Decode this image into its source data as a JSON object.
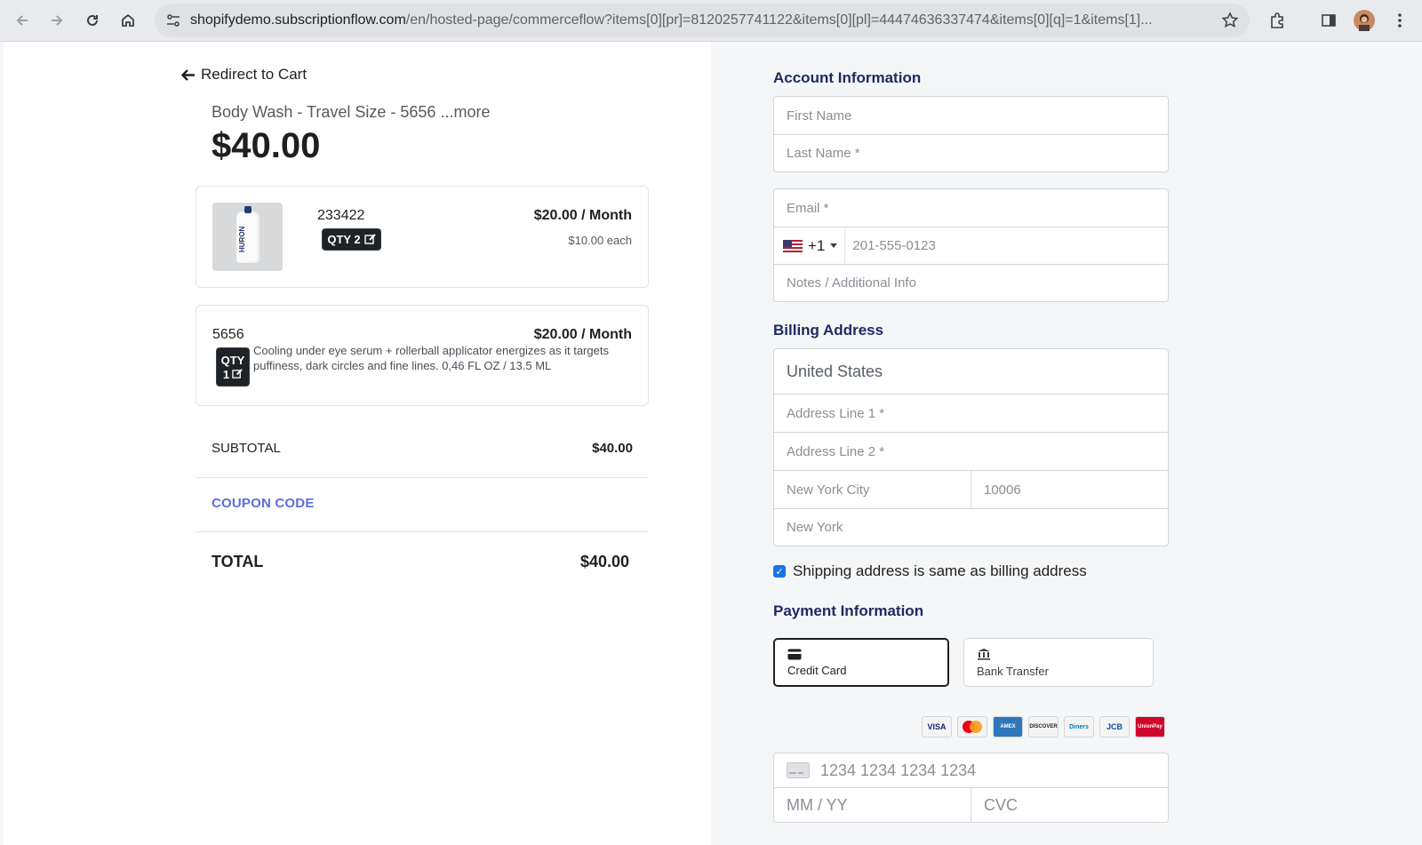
{
  "browser": {
    "url_host": "shopifydemo.subscriptionflow.com",
    "url_path": "/en/hosted-page/commerceflow?items[0][pr]=8120257741122&items[0][pl]=44474636337474&items[0][q]=1&items[1]..."
  },
  "cart": {
    "redirect_label": "Redirect to Cart",
    "product_title": "Body Wash - Travel Size - 5656",
    "more_label": " ...more",
    "price": "$40.00",
    "items": [
      {
        "sku": "233422",
        "qty": "QTY 2",
        "price": "$20.00 / Month",
        "each": "$10.00 each",
        "brand": "HURON"
      },
      {
        "sku": "5656",
        "qty_line1": "QTY",
        "qty_line2": "1",
        "price": "$20.00 / Month",
        "description": "Cooling under eye serum + rollerball applicator energizes as it targets puffiness, dark circles and fine lines. 0,46 FL OZ / 13.5 ML"
      }
    ],
    "subtotal_label": "SUBTOTAL",
    "subtotal_value": "$40.00",
    "coupon_label": "COUPON CODE",
    "total_label": "TOTAL",
    "total_value": "$40.00"
  },
  "account": {
    "title": "Account Information",
    "first_name_ph": "First Name",
    "last_name_ph": "Last Name *",
    "email_ph": "Email *",
    "phone_code": "+1",
    "phone_ph": "201-555-0123",
    "notes_ph": "Notes / Additional Info"
  },
  "billing": {
    "title": "Billing Address",
    "country": "United States",
    "address1_ph": "Address Line 1 *",
    "address2_ph": "Address Line 2 *",
    "city": "New York City",
    "zip": "10006",
    "state": "New York",
    "same_shipping_label": "Shipping address is same as billing address"
  },
  "payment": {
    "title": "Payment Information",
    "credit_card_label": "Credit Card",
    "bank_transfer_label": "Bank Transfer",
    "card_brands": [
      "VISA",
      "MC",
      "AMEX",
      "DISCOVER",
      "Diners",
      "JCB",
      "UnionPay"
    ],
    "card_number_ph": "1234 1234 1234 1234",
    "expiry_ph": "MM / YY",
    "cvc_ph": "CVC"
  },
  "colors": {
    "accent": "#5b6ee1",
    "section_title": "#1d2b63",
    "checkbox": "#1a73e8"
  }
}
